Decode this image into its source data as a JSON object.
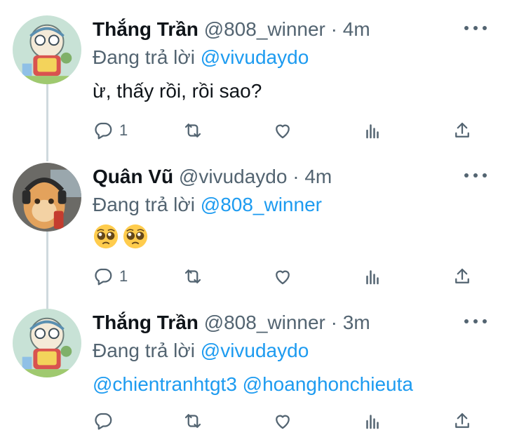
{
  "tweets": [
    {
      "name": "Thắng Trần",
      "handle": "@808_winner",
      "sep": " · ",
      "time": "4m",
      "reply_prefix": "Đang trả lời ",
      "reply_to": "@vivudaydo",
      "text": "ừ, thấy rồi, rồi sao?",
      "reply_count": "1",
      "avatar_icon": "anime-character-avatar"
    },
    {
      "name": "Quân Vũ",
      "handle": "@vivudaydo",
      "sep": " · ",
      "time": "4m",
      "reply_prefix": "Đang trả lời ",
      "reply_to": "@808_winner",
      "emojis": [
        "pleading-face-emoji",
        "pleading-face-emoji"
      ],
      "reply_count": "1",
      "avatar_icon": "cat-with-headphones-avatar"
    },
    {
      "name": "Thắng Trần",
      "handle": "@808_winner",
      "sep": " · ",
      "time": "3m",
      "reply_prefix": "Đang trả lời ",
      "reply_to": "@vivudaydo",
      "mentions": [
        "@chientranhtgt3",
        "@hoanghonchieuta"
      ],
      "reply_count": "",
      "avatar_icon": "anime-character-avatar"
    }
  ],
  "colors": {
    "accent": "#1d9bf0",
    "secondary_text": "#536471",
    "primary_text": "#0f1419",
    "thread_line": "#cfd9de"
  },
  "action_icons": [
    "reply-icon",
    "retweet-icon",
    "like-icon",
    "analytics-icon",
    "share-icon"
  ]
}
